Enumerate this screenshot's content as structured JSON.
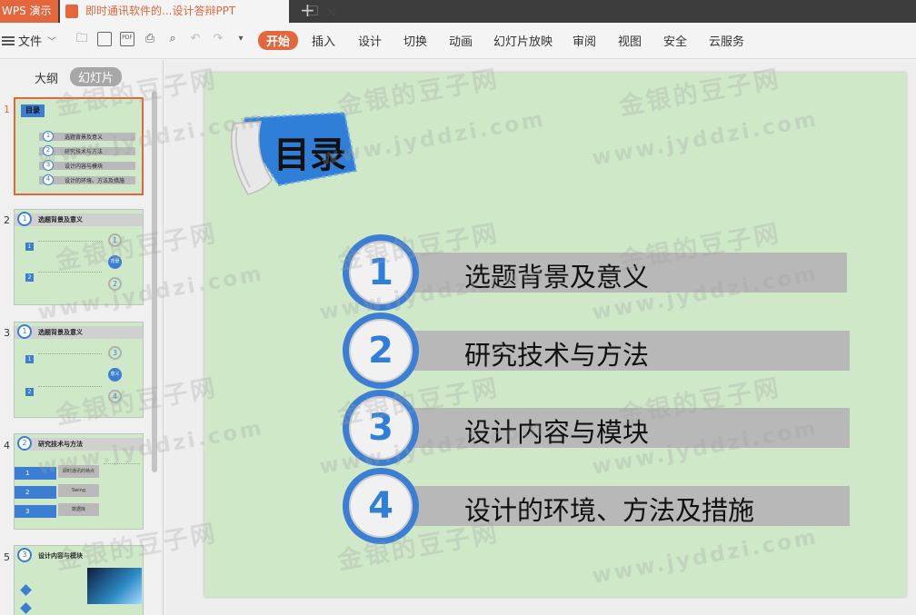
{
  "tabs": {
    "app_label": "WPS 演示",
    "doc_title": "即时通讯软件的...设计答辩PPT",
    "close_glyph": "✕",
    "add_glyph": "+"
  },
  "toolbar": {
    "file_label": "文件",
    "ribbon_tabs": [
      "开始",
      "插入",
      "设计",
      "切换",
      "动画",
      "幻灯片放映",
      "审阅",
      "视图",
      "安全",
      "云服务"
    ],
    "active_tab": "开始",
    "accent_color": "#e4663d"
  },
  "left_panel": {
    "view_tabs": {
      "outline": "大纲",
      "slides": "幻灯片"
    },
    "selected_slide": 1,
    "thumbnails": [
      {
        "num": "1",
        "title": "目录",
        "items": [
          "选题背景及意义",
          "研究技术与方法",
          "设计内容与模块",
          "设计的环境、方法及措施"
        ]
      },
      {
        "num": "2",
        "title": "选题背景及意义",
        "badge": "1",
        "center_label": "背景"
      },
      {
        "num": "3",
        "title": "选题背景及意义",
        "badge": "1",
        "center_label": "意义"
      },
      {
        "num": "4",
        "title": "研究技术与方法",
        "badge": "2",
        "rows": [
          "即时通讯的特点",
          "Swing",
          "数据库"
        ]
      },
      {
        "num": "5",
        "title": "设计内容与模块",
        "badge": "3"
      }
    ]
  },
  "slide": {
    "badge_text": "目录",
    "toc": [
      {
        "num": "1",
        "label": "选题背景及意义"
      },
      {
        "num": "2",
        "label": "研究技术与方法"
      },
      {
        "num": "3",
        "label": "设计内容与模块"
      },
      {
        "num": "4",
        "label": "设计的环境、方法及措施"
      }
    ],
    "bg_color": "#cfe8c8",
    "circle_color": "#3b7ed4"
  },
  "watermark": {
    "text_cn": "金银的豆子网",
    "text_url": "www.jyddzi.com"
  }
}
